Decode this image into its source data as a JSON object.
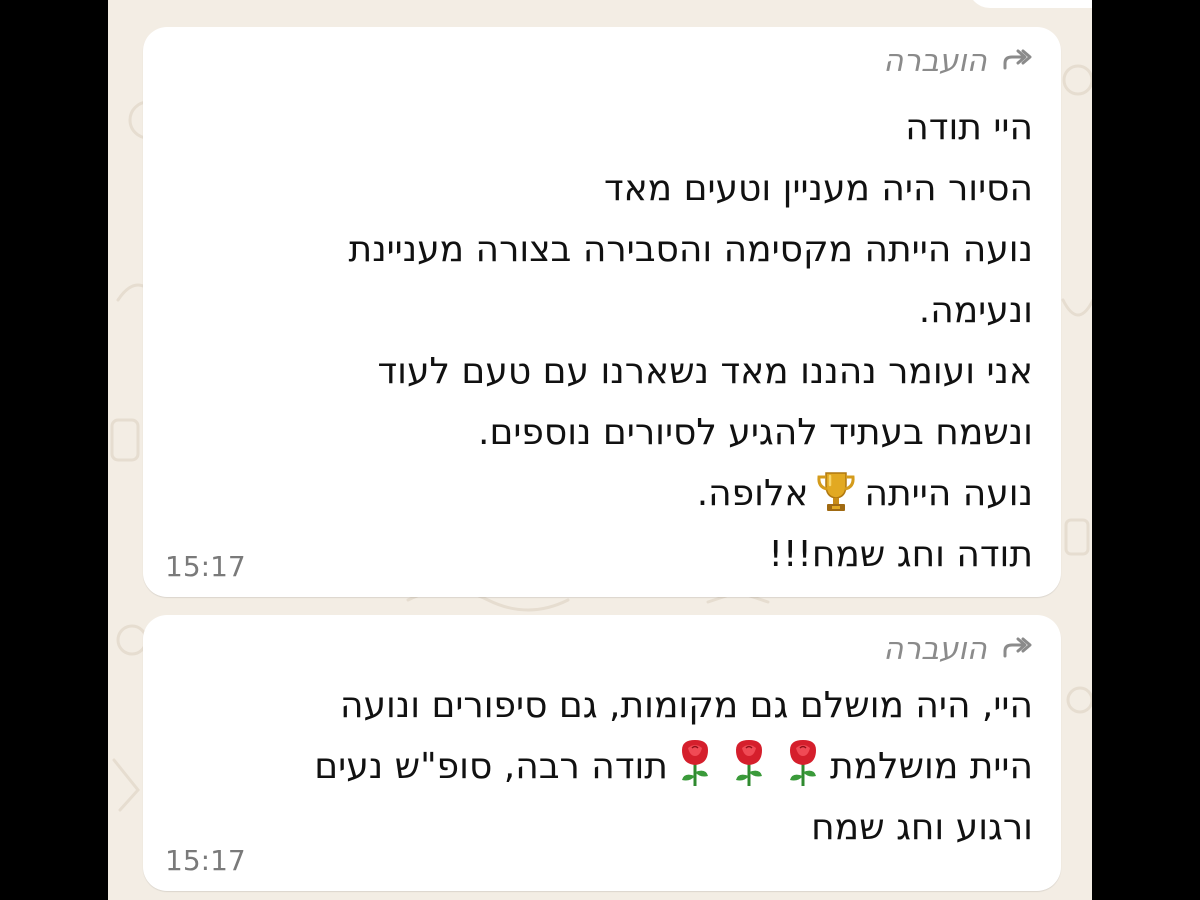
{
  "messages": [
    {
      "forwarded_label": "הועברה",
      "lines": [
        "היי תודה",
        "הסיור היה מעניין וטעים מאד",
        "נועה הייתה מקסימה והסבירה בצורה מעניינת",
        "ונעימה.",
        "אני ועומר נהננו מאד נשארנו עם טעם לעוד",
        "ונשמח בעתיד להגיע לסיורים נוספים.",
        "נועה הייתה",
        "אלופה.",
        "תודה וחג שמח!!!"
      ],
      "time": "15:17",
      "emoji": "trophy-icon"
    },
    {
      "forwarded_label": "הועברה",
      "lines": [
        "היי, היה מושלם גם מקומות, גם סיפורים ונועה",
        "היית מושלמת",
        "תודה רבה, סופ\"ש נעים",
        "ורגוע וחג שמח"
      ],
      "time": "15:17",
      "emoji": "rose-icon"
    }
  ],
  "colors": {
    "wallpaper": "#f3ede4",
    "bubble": "#ffffff",
    "text": "#111111",
    "meta": "#8b8b8b"
  }
}
